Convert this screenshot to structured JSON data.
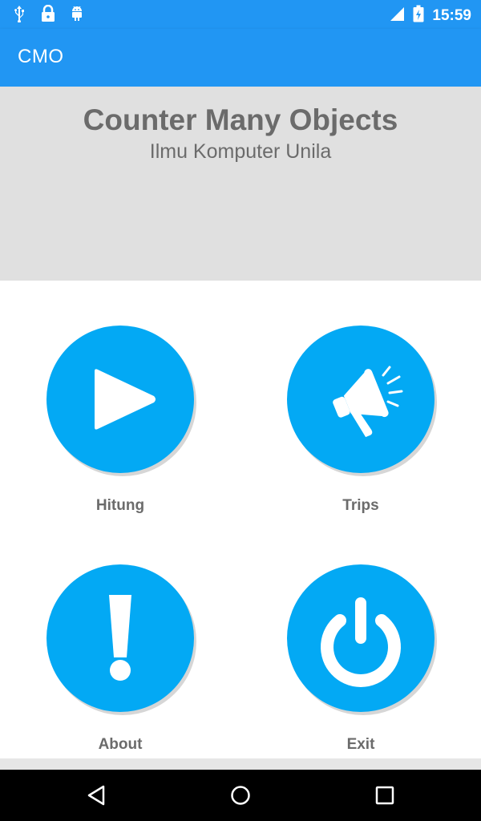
{
  "status_bar": {
    "time": "15:59",
    "left_icons": [
      "usb-icon",
      "lock-icon",
      "android-icon"
    ],
    "right_icons": [
      "signal-icon",
      "battery-charging-icon"
    ]
  },
  "app_bar": {
    "title": "CMO"
  },
  "header": {
    "title": "Counter Many Objects",
    "subtitle": "Ilmu Komputer Unila"
  },
  "menu": {
    "items": [
      {
        "label": "Hitung",
        "icon": "play-icon"
      },
      {
        "label": "Trips",
        "icon": "megaphone-icon"
      },
      {
        "label": "About",
        "icon": "exclamation-icon"
      },
      {
        "label": "Exit",
        "icon": "power-icon"
      }
    ]
  },
  "nav_bar": {
    "buttons": [
      "back-icon",
      "home-icon",
      "recents-icon"
    ]
  },
  "colors": {
    "primary": "#2196f3",
    "accent": "#03a9f4",
    "header_bg": "#e0e0e0",
    "text_gray": "#6b6b6b"
  }
}
